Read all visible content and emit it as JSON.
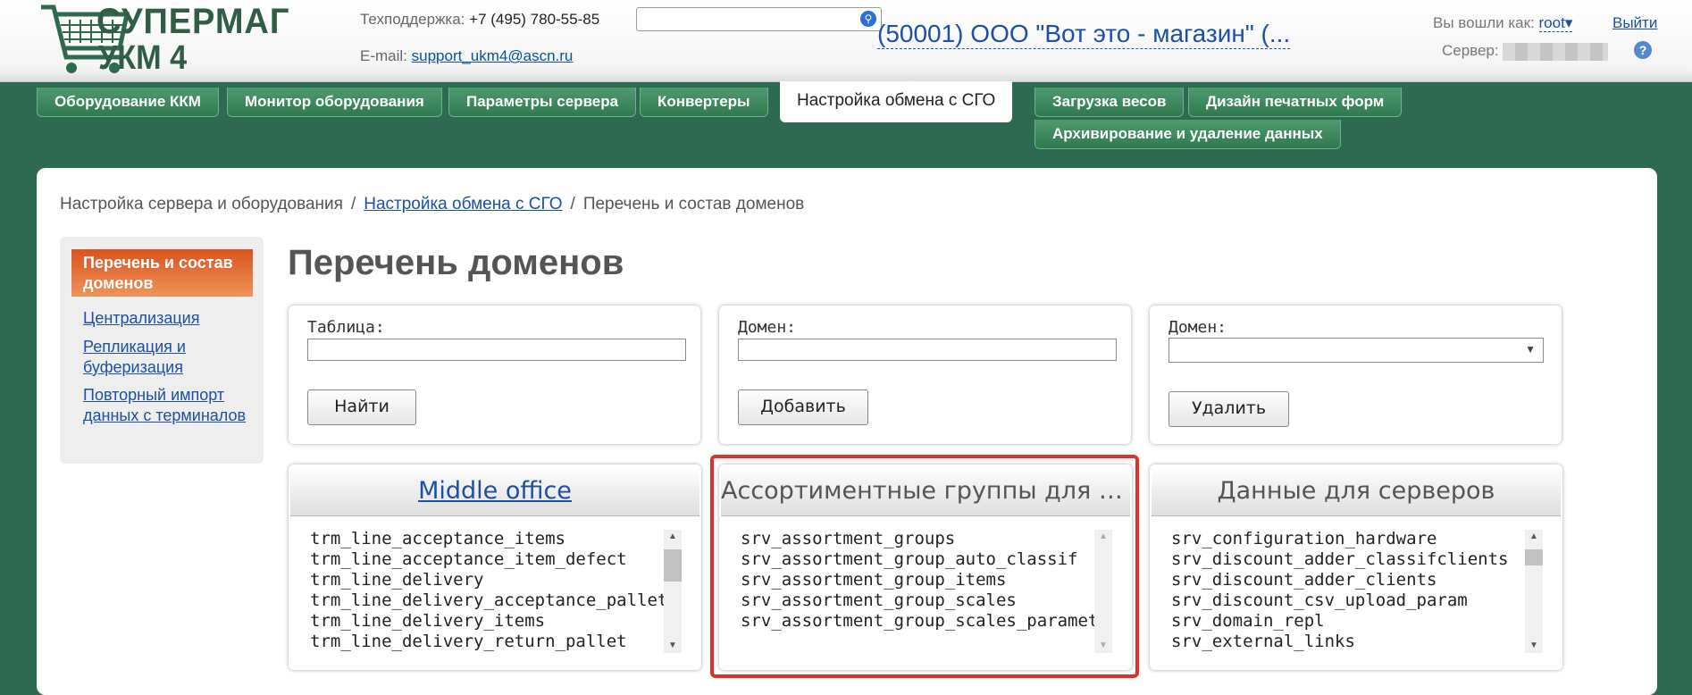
{
  "header": {
    "logo_line1": "СУПЕРМАГ",
    "logo_line2": "УКМ 4",
    "support_label": "Техподдержка:",
    "support_phone": "+7 (495) 780-55-85",
    "email_label": "E-mail:",
    "email": "support_ukm4@ascn.ru",
    "search_value": "",
    "store": "(50001) ООО \"Вот это - магазин\" (...",
    "logged_as_label": "Вы вошли как:",
    "user": "root",
    "logout": "Выйти",
    "server_label": "Сервер:",
    "help": "?"
  },
  "tabs": [
    "Оборудование ККМ",
    "Монитор оборудования",
    "Параметры сервера",
    "Конвертеры",
    "Настройка обмена с СГО",
    "Загрузка весов",
    "Дизайн печатных форм",
    "Архивирование и удаление данных"
  ],
  "breadcrumb": {
    "root": "Настройка сервера и оборудования",
    "link": "Настройка обмена с СГО",
    "current": "Перечень и состав доменов",
    "separator": "/"
  },
  "leftnav": {
    "active": "Перечень и состав доменов",
    "links": [
      "Централизация",
      "Репликация и буферизация",
      "Повторный импорт данных с терминалов"
    ]
  },
  "page_title": "Перечень доменов",
  "forms": {
    "table_label": "Таблица:",
    "table_value": "",
    "find_button": "Найти",
    "domain_add_label": "Домен:",
    "domain_add_value": "",
    "add_button": "Добавить",
    "domain_delete_label": "Домен:",
    "domain_delete_selected": "",
    "delete_button": "Удалить"
  },
  "lists": [
    {
      "title": "Middle office",
      "items": [
        "trm_line_acceptance_items",
        "trm_line_acceptance_item_defect",
        "trm_line_delivery",
        "trm_line_delivery_acceptance_pallet",
        "trm_line_delivery_items",
        "trm_line_delivery_return_pallet"
      ]
    },
    {
      "title": "Ассортиментные группы для в...",
      "items": [
        "srv_assortment_groups",
        "srv_assortment_group_auto_classif",
        "srv_assortment_group_items",
        "srv_assortment_group_scales",
        "srv_assortment_group_scales_paramet"
      ]
    },
    {
      "title": "Данные для серверов",
      "items": [
        "srv_configuration_hardware",
        "srv_discount_adder_classifclients",
        "srv_discount_adder_clients",
        "srv_discount_csv_upload_param",
        "srv_domain_repl",
        "srv_external_links"
      ]
    }
  ],
  "colors": {
    "background": "#2e6a52",
    "tab": "#3d8a5e",
    "active_nav": "#e0652a",
    "link": "#1c4fa5",
    "highlight": "#e0302a"
  }
}
